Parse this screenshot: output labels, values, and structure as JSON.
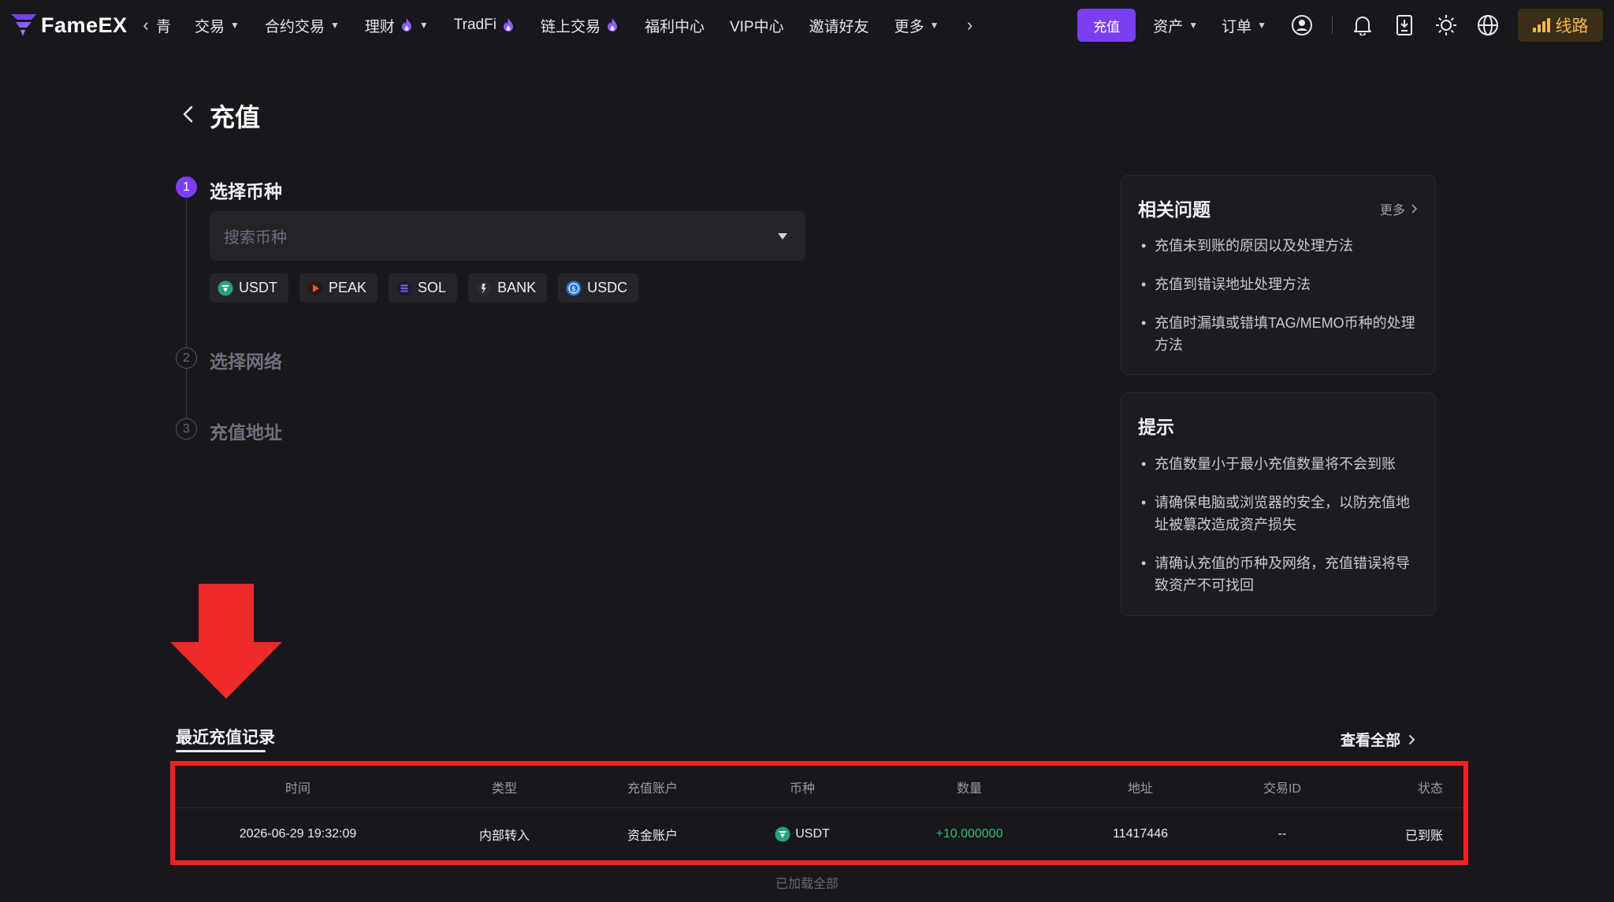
{
  "brand": {
    "name": "FameEX"
  },
  "nav": {
    "partial_item": "青",
    "items": [
      {
        "label": "交易",
        "dropdown": true,
        "hot": false
      },
      {
        "label": "合约交易",
        "dropdown": true,
        "hot": false
      },
      {
        "label": "理财",
        "dropdown": true,
        "hot": true
      },
      {
        "label": "TradFi",
        "dropdown": false,
        "hot": true
      },
      {
        "label": "链上交易",
        "dropdown": false,
        "hot": true
      },
      {
        "label": "福利中心",
        "dropdown": false,
        "hot": false
      },
      {
        "label": "VIP中心",
        "dropdown": false,
        "hot": false
      },
      {
        "label": "邀请好友",
        "dropdown": false,
        "hot": false
      },
      {
        "label": "更多",
        "dropdown": true,
        "hot": false
      }
    ],
    "deposit_button": "充值",
    "assets": "资产",
    "orders": "订单",
    "route_button": "线路",
    "icons": [
      "user-icon",
      "bell-icon",
      "download-app-icon",
      "theme-sun-icon",
      "globe-icon"
    ]
  },
  "page": {
    "title": "充值"
  },
  "steps": [
    {
      "num": "1",
      "title": "选择币种",
      "active": true
    },
    {
      "num": "2",
      "title": "选择网络",
      "active": false
    },
    {
      "num": "3",
      "title": "充值地址",
      "active": false
    }
  ],
  "coin_search": {
    "placeholder": "搜索币种"
  },
  "quick_coins": [
    {
      "symbol": "USDT",
      "icon": "usdt-icon",
      "color": "#26a17b"
    },
    {
      "symbol": "PEAK",
      "icon": "peak-icon",
      "color": "#e8552b"
    },
    {
      "symbol": "SOL",
      "icon": "sol-icon",
      "color": "#7b61ff"
    },
    {
      "symbol": "BANK",
      "icon": "bank-icon",
      "color": "#d9d9d9"
    },
    {
      "symbol": "USDC",
      "icon": "usdc-icon",
      "color": "#2775ca"
    }
  ],
  "faq": {
    "title": "相关问题",
    "more": "更多",
    "items": [
      "充值未到账的原因以及处理方法",
      "充值到错误地址处理方法",
      "充值时漏填或错填TAG/MEMO币种的处理方法"
    ]
  },
  "tips": {
    "title": "提示",
    "items": [
      "充值数量小于最小充值数量将不会到账",
      "请确保电脑或浏览器的安全，以防充值地址被篡改造成资产损失",
      "请确认充值的币种及网络，充值错误将导致资产不可找回"
    ]
  },
  "records": {
    "tab_label": "最近充值记录",
    "view_all": "查看全部",
    "columns": [
      "时间",
      "类型",
      "充值账户",
      "币种",
      "数量",
      "地址",
      "交易ID",
      "状态"
    ],
    "rows": [
      {
        "time": "2026-06-29 19:32:09",
        "type": "内部转入",
        "account": "资金账户",
        "coin": "USDT",
        "amount": "+10.000000",
        "address": "11417446",
        "txid": "--",
        "status": "已到账"
      }
    ],
    "footer": "已加载全部"
  },
  "colors": {
    "background": "#17171c",
    "accent": "#7b3ff2",
    "positive": "#2fbf71",
    "highlight": "#ef2222",
    "route": "#f2b84b"
  }
}
